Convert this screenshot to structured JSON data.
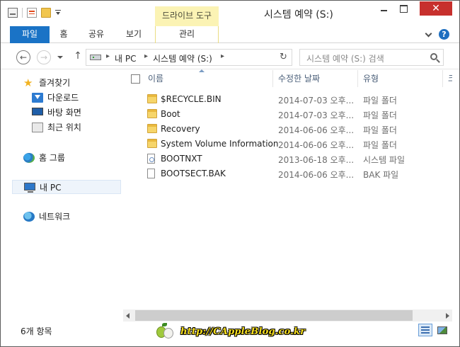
{
  "window": {
    "title": "시스템 예약 (S:)",
    "context_tab_title": "드라이브 도구",
    "close_label": "✕"
  },
  "ribbon": {
    "tabs": [
      "파일",
      "홈",
      "공유",
      "보기",
      "관리"
    ],
    "help_label": "?"
  },
  "address": {
    "segments": [
      "내 PC",
      "시스템 예약 (S:)"
    ],
    "search_placeholder": "시스템 예약 (S:) 검색"
  },
  "nav_pane": {
    "favorites": {
      "label": "즐겨찾기",
      "items": [
        "다운로드",
        "바탕 화면",
        "최근 위치"
      ]
    },
    "homegroup": "홈 그룹",
    "this_pc": "내 PC",
    "network": "네트워크"
  },
  "columns": {
    "name": "이름",
    "modified": "수정한 날짜",
    "type": "유형",
    "size_partial": "크"
  },
  "files": [
    {
      "name": "$RECYCLE.BIN",
      "modified": "2014-07-03 오후...",
      "type": "파일 폴더",
      "icon": "folder-icon"
    },
    {
      "name": "Boot",
      "modified": "2014-07-03 오후...",
      "type": "파일 폴더",
      "icon": "folder-icon"
    },
    {
      "name": "Recovery",
      "modified": "2014-06-06 오후...",
      "type": "파일 폴더",
      "icon": "folder-icon"
    },
    {
      "name": "System Volume Information",
      "modified": "2014-06-06 오후...",
      "type": "파일 폴더",
      "icon": "folder-icon"
    },
    {
      "name": "BOOTNXT",
      "modified": "2013-06-18 오후...",
      "type": "시스템 파일",
      "icon": "system-file-icon"
    },
    {
      "name": "BOOTSECT.BAK",
      "modified": "2014-06-06 오후...",
      "type": "BAK 파일",
      "icon": "file-icon"
    }
  ],
  "status": {
    "item_count": "6개 항목"
  },
  "watermark": {
    "text": "http://CAppleBlog.co.kr"
  },
  "colors": {
    "file_tab": "#1a73c6",
    "context_tab": "#fbf3b4",
    "close_button": "#c7302d",
    "selection": "#eef4fb"
  }
}
